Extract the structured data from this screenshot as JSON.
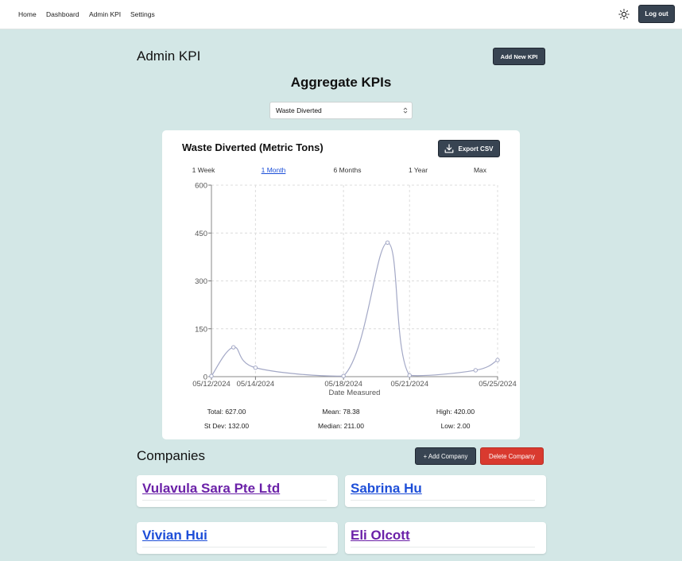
{
  "nav": {
    "links": [
      "Home",
      "Dashboard",
      "Admin KPI",
      "Settings"
    ],
    "logout_label": "Log out",
    "theme_icon": "sun-icon"
  },
  "header": {
    "title": "Admin KPI",
    "add_kpi_label": "Add New KPI"
  },
  "aggregate": {
    "title": "Aggregate KPIs",
    "selected_kpi": "Waste Diverted"
  },
  "chart_card": {
    "title": "Waste Diverted (Metric Tons)",
    "export_label": "Export CSV",
    "ranges": [
      "1 Week",
      "1 Month",
      "6 Months",
      "1 Year",
      "Max"
    ],
    "active_range": "1 Month"
  },
  "chart_data": {
    "type": "line",
    "title": "Waste Diverted (Metric Tons)",
    "xlabel": "Date Measured",
    "ylabel": "",
    "x_tick_labels": [
      "05/12/2024",
      "05/14/2024",
      "05/18/2024",
      "05/21/2024",
      "05/25/2024"
    ],
    "y_ticks": [
      0,
      150,
      300,
      450,
      600
    ],
    "ylim": [
      0,
      600
    ],
    "xlim": [
      "05/12/2024",
      "05/25/2024"
    ],
    "grid": true,
    "series": [
      {
        "x": [
          "05/12/2024",
          "05/13/2024",
          "05/14/2024",
          "05/18/2024",
          "05/20/2024",
          "05/21/2024",
          "05/24/2024",
          "05/25/2024"
        ],
        "values": [
          2,
          92,
          28,
          2,
          420,
          4,
          20,
          52
        ],
        "color": "#a3a8c6"
      }
    ]
  },
  "stats": {
    "total": "Total: 627.00",
    "mean": "Mean: 78.38",
    "high": "High: 420.00",
    "stdev": "St Dev: 132.00",
    "median": "Median: 211.00",
    "low": "Low: 2.00"
  },
  "companies": {
    "title": "Companies",
    "add_label": "+ Add Company",
    "delete_label": "Delete Company",
    "items": [
      {
        "name": "Vulavula Sara Pte Ltd",
        "color": "#6b21a8"
      },
      {
        "name": "Sabrina Hu",
        "color": "#1d4ed8"
      },
      {
        "name": "Vivian Hui",
        "color": "#1d4ed8"
      },
      {
        "name": "Eli Olcott",
        "color": "#6b21a8"
      }
    ]
  },
  "colors": {
    "background": "#d3e7e6",
    "button_dark": "#384452",
    "button_danger": "#d93a2f",
    "active_link": "#1a4ed8"
  }
}
